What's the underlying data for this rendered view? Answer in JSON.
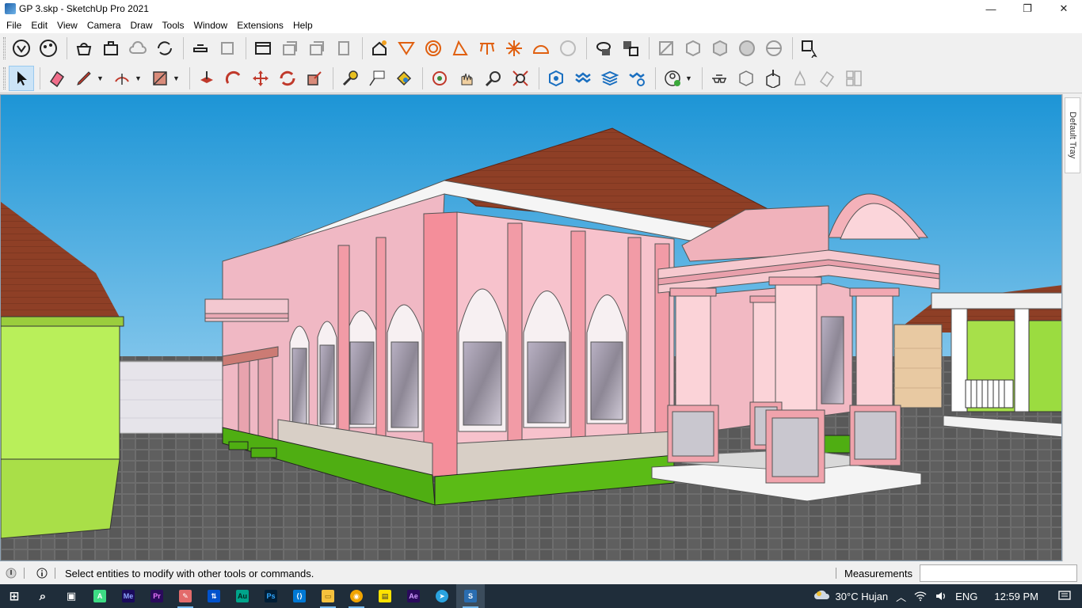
{
  "window": {
    "title": "GP 3.skp - SketchUp Pro 2021",
    "minimize_glyph": "—",
    "maximize_glyph": "❐",
    "close_glyph": "✕"
  },
  "menu": [
    "File",
    "Edit",
    "View",
    "Camera",
    "Draw",
    "Tools",
    "Window",
    "Extensions",
    "Help"
  ],
  "toolbar1_icons": [
    "sketchup-logo-icon",
    "styles-icon",
    "warehouse-icon",
    "extension-warehouse-icon",
    "cloud-icon",
    "sync-icon",
    "layout-icon",
    "layout-send-icon",
    "view-iso-icon",
    "view-top-icon",
    "view-front-icon",
    "view-right-icon",
    "shadow-icon",
    "section-plane-icon",
    "sphere-icon",
    "triangle-icon",
    "table-icon",
    "sun-icon",
    "dome-icon",
    "cube-disabled-icon",
    "solid-union-icon",
    "solid-subtract-icon",
    "xray-icon",
    "wireframe-icon",
    "hidden-line-icon",
    "shaded-icon",
    "textured-icon",
    "monochrome-icon",
    "component-cursor-icon"
  ],
  "toolbar2_icons": [
    "select-icon",
    "eraser-icon",
    "pencil-icon",
    "arc-icon",
    "rectangle-icon",
    "push-pull-icon",
    "follow-me-icon",
    "move-icon",
    "rotate-icon",
    "scale-icon",
    "tape-measure-icon",
    "text-icon",
    "paint-bucket-icon",
    "orbit-icon",
    "pan-icon",
    "zoom-icon",
    "zoom-extents-icon",
    "sandbox-icon",
    "layers-icon",
    "outliner-icon",
    "settings-icon",
    "user-icon",
    "glasses-icon",
    "box-icon",
    "box-open-icon",
    "flame-icon",
    "pattern-icon",
    "layout-tiles-icon"
  ],
  "tray": {
    "label": "Default Tray"
  },
  "status": {
    "message": "Select entities to modify with other tools or commands.",
    "measurements_label": "Measurements",
    "measurements_value": ""
  },
  "taskbar": {
    "apps": [
      {
        "name": "start",
        "color": "#ffffff",
        "label": "⊞"
      },
      {
        "name": "search",
        "color": "#ffffff",
        "label": "⌕"
      },
      {
        "name": "task-view",
        "color": "#ffffff",
        "label": "▣"
      },
      {
        "name": "android-studio",
        "color": "#3ddc84",
        "label": "A"
      },
      {
        "name": "media-encoder",
        "color": "#1a0a5c",
        "label": "Me"
      },
      {
        "name": "premiere",
        "color": "#2a0a5c",
        "label": "Pr"
      },
      {
        "name": "paint",
        "color": "#e36b6b",
        "label": "✎"
      },
      {
        "name": "sourcetree",
        "color": "#0052cc",
        "label": "⇅"
      },
      {
        "name": "audition",
        "color": "#00a58b",
        "label": "Au"
      },
      {
        "name": "photoshop",
        "color": "#001e36",
        "label": "Ps"
      },
      {
        "name": "vscode",
        "color": "#0078d4",
        "label": "⟨⟩"
      },
      {
        "name": "file-explorer",
        "color": "#f5c13d",
        "label": "▭"
      },
      {
        "name": "chrome",
        "color": "#f1a400",
        "label": "◉"
      },
      {
        "name": "sticky-notes",
        "color": "#ffe200",
        "label": "▤"
      },
      {
        "name": "after-effects",
        "color": "#2a0a5c",
        "label": "Ae"
      },
      {
        "name": "telegram",
        "color": "#2aa3df",
        "label": "➤"
      },
      {
        "name": "sketchup",
        "color": "#2a6db0",
        "label": "S"
      }
    ],
    "weather": "30°C  Hujan",
    "language": "ENG",
    "time": "12:59 PM"
  }
}
